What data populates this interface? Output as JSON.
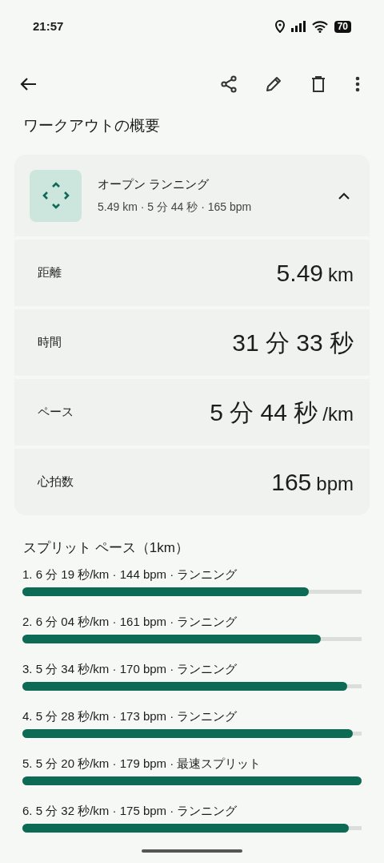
{
  "status_bar": {
    "time": "21:57",
    "battery": "70"
  },
  "title": "ワークアウトの概要",
  "workout": {
    "name": "オープン ランニング",
    "summary": "5.49 km · 5 分 44 秒 · 165 bpm",
    "expanded": true,
    "metrics": [
      {
        "label": "距離",
        "value": "5.49",
        "unit": "km"
      },
      {
        "label": "時間",
        "value": "31 分 33 秒"
      },
      {
        "label": "ペース",
        "value": "5 分 44 秒",
        "unit": "/km"
      },
      {
        "label": "心拍数",
        "value": "165",
        "unit": "bpm"
      }
    ]
  },
  "splits": {
    "title": "スプリット ペース（1km）",
    "items": [
      {
        "text": "1. 6 分 19 秒/km · 144 bpm · ランニング",
        "level": 0.844
      },
      {
        "text": "2. 6 分 04 秒/km · 161 bpm · ランニング",
        "level": 0.88
      },
      {
        "text": "3. 5 分 34 秒/km · 170 bpm · ランニング",
        "level": 0.958
      },
      {
        "text": "4. 5 分 28 秒/km · 173 bpm · ランニング",
        "level": 0.974
      },
      {
        "text": "5. 5 分 20 秒/km · 179 bpm · 最速スプリット",
        "level": 1
      },
      {
        "text": "6. 5 分 32 秒/km · 175 bpm · ランニング",
        "level": 0.962
      }
    ]
  }
}
